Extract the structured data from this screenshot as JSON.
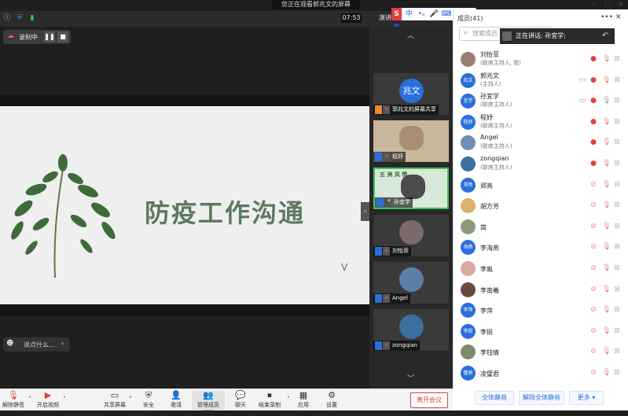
{
  "notice": "您正在观看郭兆文的屏幕",
  "clock": "07:53",
  "ime": {
    "logo": "S",
    "lang": "中"
  },
  "recording": "录制中",
  "slide": {
    "title": "防疫工作沟通"
  },
  "chat_placeholder": "说点什么...",
  "gallery": [
    {
      "name": "郭兆文的屏幕共享",
      "avatar_text": "兆文",
      "color": "#2a6fdb"
    },
    {
      "name": "程妤",
      "color": "#a98f72"
    },
    {
      "name": "孙宜学",
      "color": "#4b8b5a"
    },
    {
      "name": "刘怡菲",
      "color": "#7a6a6a"
    },
    {
      "name": "Angel",
      "color": "#5a7fa8"
    },
    {
      "name": "zongqian",
      "color": "#3d6fa0"
    }
  ],
  "toolbar": [
    {
      "label": "解除静音",
      "icon": "mic-muted-icon"
    },
    {
      "label": "开启视频",
      "icon": "camera-off-icon"
    },
    {
      "label": "共享屏幕",
      "icon": "share-screen-icon"
    },
    {
      "label": "安全",
      "icon": "shield-icon"
    },
    {
      "label": "邀请",
      "icon": "invite-icon"
    },
    {
      "label": "管理成员(41)",
      "icon": "members-icon"
    },
    {
      "label": "聊天",
      "icon": "chat-icon"
    },
    {
      "label": "结束录制",
      "icon": "stop-record-icon"
    },
    {
      "label": "应用",
      "icon": "apps-icon"
    },
    {
      "label": "设置",
      "icon": "gear-icon"
    }
  ],
  "leave_label": "离开会议",
  "panel": {
    "title": "成员(41)",
    "search_placeholder": "搜索成员",
    "speaking": "正在讲话: 孙宜学;",
    "members": [
      {
        "name": "刘怡菲",
        "role": "(联席主持人, 我)",
        "avatar": "",
        "color": "#9a7f6f",
        "video": "on",
        "mic": "off"
      },
      {
        "name": "郭兆文",
        "role": "(主持人)",
        "avatar": "兆文",
        "color": "#2a6fdb",
        "video": "on",
        "mic": "off"
      },
      {
        "name": "孙宜学",
        "role": "(联席主持人)",
        "avatar": "宜学",
        "color": "#2a6fdb",
        "video": "on",
        "mic": "on"
      },
      {
        "name": "程妤",
        "role": "(联席主持人)",
        "avatar": "程妤",
        "color": "#2a6fdb",
        "video": "on",
        "mic": "off"
      },
      {
        "name": "Angel",
        "role": "(联席主持人)",
        "avatar": "",
        "color": "#6b8fb5",
        "video": "on",
        "mic": "off"
      },
      {
        "name": "zongqian",
        "role": "(联席主持人)",
        "avatar": "",
        "color": "#3d6fa0",
        "video": "on",
        "mic": "off"
      },
      {
        "name": "郑亮",
        "role": "",
        "avatar": "郑亮",
        "color": "#2a6fdb",
        "video": "off",
        "mic": "off"
      },
      {
        "name": "胡方芳",
        "role": "",
        "avatar": "",
        "color": "#d9b36a",
        "video": "off",
        "mic": "off"
      },
      {
        "name": "简",
        "role": "",
        "avatar": "",
        "color": "#8a9a7a",
        "video": "off",
        "mic": "off"
      },
      {
        "name": "李海燕",
        "role": "",
        "avatar": "海燕",
        "color": "#2a6fdb",
        "video": "off",
        "mic": "off"
      },
      {
        "name": "李胤",
        "role": "",
        "avatar": "",
        "color": "#d9a9a0",
        "video": "off",
        "mic": "off"
      },
      {
        "name": "李南羲",
        "role": "",
        "avatar": "",
        "color": "#6a4a3a",
        "video": "off",
        "mic": "off"
      },
      {
        "name": "李萍",
        "role": "",
        "avatar": "李萍",
        "color": "#2a6fdb",
        "video": "off",
        "mic": "off"
      },
      {
        "name": "李挺",
        "role": "",
        "avatar": "李挺",
        "color": "#2a6fdb",
        "video": "off",
        "mic": "off"
      },
      {
        "name": "李钰倩",
        "role": "",
        "avatar": "",
        "color": "#7a8a6a",
        "video": "off",
        "mic": "off"
      },
      {
        "name": "凌璧君",
        "role": "",
        "avatar": "璧君",
        "color": "#2a6fdb",
        "video": "off",
        "mic": "off"
      }
    ],
    "footer": {
      "mute_all": "全体静音",
      "unmute_all": "解除全体静音",
      "more": "更多"
    }
  }
}
